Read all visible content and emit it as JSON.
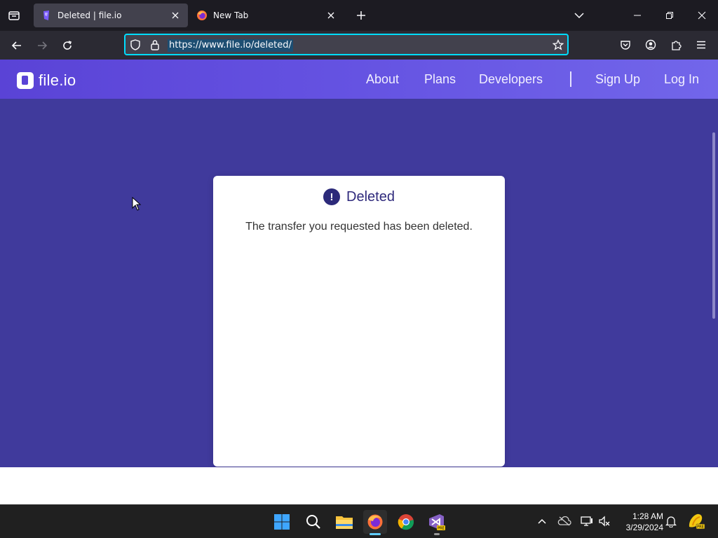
{
  "browser": {
    "tabs": [
      {
        "title": "Deleted | file.io",
        "active": true,
        "icon": "fileio-favicon"
      },
      {
        "title": "New Tab",
        "active": false,
        "icon": "firefox-icon"
      }
    ],
    "url": "https://www.file.io/deleted/"
  },
  "site": {
    "logo_text": "file.io",
    "nav": {
      "about": "About",
      "plans": "Plans",
      "developers": "Developers",
      "signup": "Sign Up",
      "login": "Log In"
    }
  },
  "card": {
    "icon_glyph": "!",
    "title": "Deleted",
    "message": "The transfer you requested has been deleted."
  },
  "taskbar": {
    "time": "1:28 AM",
    "date": "3/29/2024",
    "apps": [
      "start-icon",
      "search-icon",
      "file-explorer-icon",
      "firefox-icon",
      "chrome-icon",
      "visual-studio-preview-icon"
    ]
  },
  "colors": {
    "page_bg": "#403a9c",
    "header_gradient_start": "#5a43d6",
    "accent_focus": "#00ddff",
    "card_title": "#2f2a7c"
  }
}
